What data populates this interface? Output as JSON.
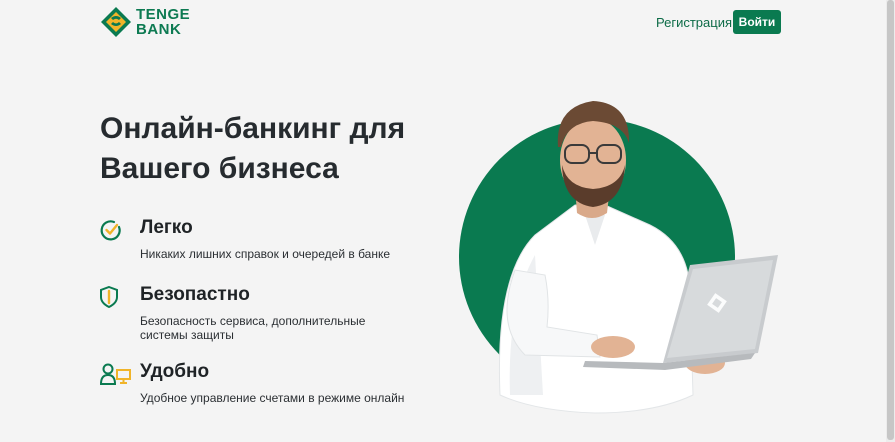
{
  "header": {
    "logo_line1": "TENGE",
    "logo_line2": "BANK",
    "register_label": "Регистрация",
    "login_label": "Войти"
  },
  "hero": {
    "title": "Онлайн-банкинг для Вашего бизнеса"
  },
  "features": [
    {
      "icon": "check-circle-icon",
      "title": "Легко",
      "description": "Никаких лишних справок и очередей в банке"
    },
    {
      "icon": "shield-icon",
      "title": "Безопастно",
      "description": "Безопасность сервиса, дополнительные системы защиты"
    },
    {
      "icon": "user-monitor-icon",
      "title": "Удобно",
      "description": "Удобное управление счетами в режиме онлайн"
    }
  ],
  "colors": {
    "brand_green": "#0a7a50",
    "accent_yellow": "#f0b429",
    "background": "#f4f4f4"
  }
}
